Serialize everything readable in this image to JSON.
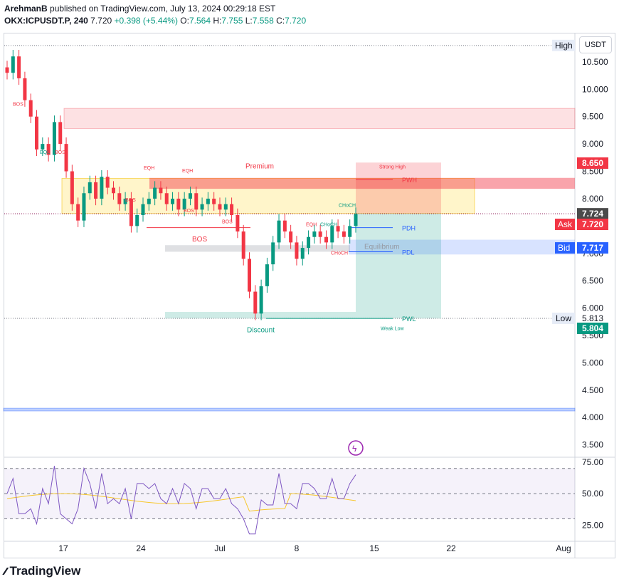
{
  "header": {
    "author": "ArehmanB",
    "published_text": "published on TradingView.com, July 13, 2024 00:29:18 EST",
    "symbol": "OKX:ICPUSDT.P, 240",
    "last": "7.720",
    "change": "+0.398 (+5.44%)",
    "o_label": "O:",
    "o": "7.564",
    "h_label": "H:",
    "h": "7.755",
    "l_label": "L:",
    "l": "7.558",
    "c_label": "C:",
    "c": "7.720"
  },
  "currency_button": "USDT",
  "logo_text": "TradingView",
  "price_axis": {
    "ticks": [
      "10.500",
      "10.000",
      "9.500",
      "9.000",
      "8.500",
      "8.000",
      "7.500",
      "7.000",
      "6.500",
      "6.000",
      "5.500",
      "5.000",
      "4.500",
      "4.000",
      "3.500"
    ],
    "high_label": "High",
    "low_label": "Low",
    "low_value": "5.813",
    "alert_price": "8.650",
    "current_price": "7.724",
    "ask_label": "Ask",
    "ask": "7.720",
    "bid_label": "Bid",
    "bid": "7.717",
    "green_price": "5.804"
  },
  "rsi_axis": {
    "ticks": [
      "75.00",
      "50.00",
      "25.00"
    ]
  },
  "time_axis": {
    "ticks": [
      "17",
      "24",
      "Jul",
      "8",
      "15",
      "22",
      "Aug"
    ]
  },
  "annotations": {
    "premium": "Premium",
    "discount": "Discount",
    "equilibrium": "Equilibrium",
    "strong_high": "Strong High",
    "weak_low": "Weak Low",
    "pwh": "PWH",
    "pdh": "PDH",
    "pdl": "PDL",
    "pwl": "PWL",
    "bos": "BOS",
    "eqh": "EQH",
    "eql": "EQL",
    "choch": "CHoCH"
  },
  "colors": {
    "up": "#089981",
    "down": "#f23645",
    "rsi": "#7e57c2",
    "rsi_ma": "#f7c72c",
    "premium_zone": "#f23645",
    "discount_zone": "#089981",
    "blue": "#2962ff"
  },
  "chart_data": {
    "type": "candlestick",
    "approx_close_series": [
      10.3,
      10.6,
      10.2,
      9.8,
      9.5,
      8.9,
      9.0,
      8.8,
      9.4,
      9.0,
      8.5,
      7.9,
      7.6,
      8.1,
      8.3,
      8.0,
      8.4,
      8.2,
      8.1,
      7.9,
      8.0,
      7.5,
      7.7,
      7.9,
      8.0,
      8.2,
      8.1,
      7.9,
      8.0,
      7.8,
      8.0,
      8.1,
      7.8,
      7.9,
      8.0,
      7.9,
      7.8,
      7.9,
      7.7,
      7.4,
      6.9,
      6.3,
      5.9,
      6.4,
      6.8,
      7.2,
      7.6,
      7.4,
      7.2,
      6.9,
      7.1,
      7.3,
      7.4,
      7.3,
      7.2,
      7.5,
      7.4,
      7.3,
      7.5,
      7.72
    ],
    "levels": {
      "high": 10.8,
      "pwh": 8.35,
      "pdh": 7.47,
      "pdl": 7.03,
      "pwl": 5.81,
      "low": 5.813
    },
    "rsi_last": 65,
    "ylim": [
      3.3,
      10.85
    ],
    "rsi_ylim": [
      15,
      80
    ]
  }
}
